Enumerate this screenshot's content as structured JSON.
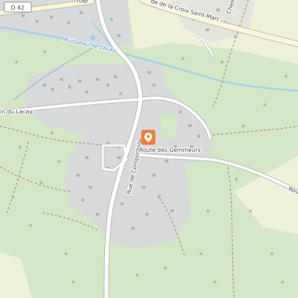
{
  "map": {
    "colors": {
      "forest": "#d4e7c7",
      "farmland": "#eef0d8",
      "urban": "#d9dadc",
      "road": "#ffffff",
      "road_casing": "#b9b9b9",
      "major_road_fill": "#fbf6d6",
      "water": "#9fd0ee",
      "marker": "#f07c3a",
      "trail": "#b9885c",
      "boundary": "#5b74d0"
    },
    "labels": {
      "road_badge": "D 42",
      "top_partial": "rtier",
      "croix_saint_marc": "de de la Croix Saint-Marc",
      "ruisseau": "Ruisseau de Lacay",
      "chemin_lacay": "in du Lacay",
      "compostelle": "Rue de Compostelle",
      "gemmeurs": "Route des Gemmeurs",
      "chemin_top": "Chemin",
      "right_partial": "Rou"
    },
    "marker_icon": "map-pin-icon"
  }
}
